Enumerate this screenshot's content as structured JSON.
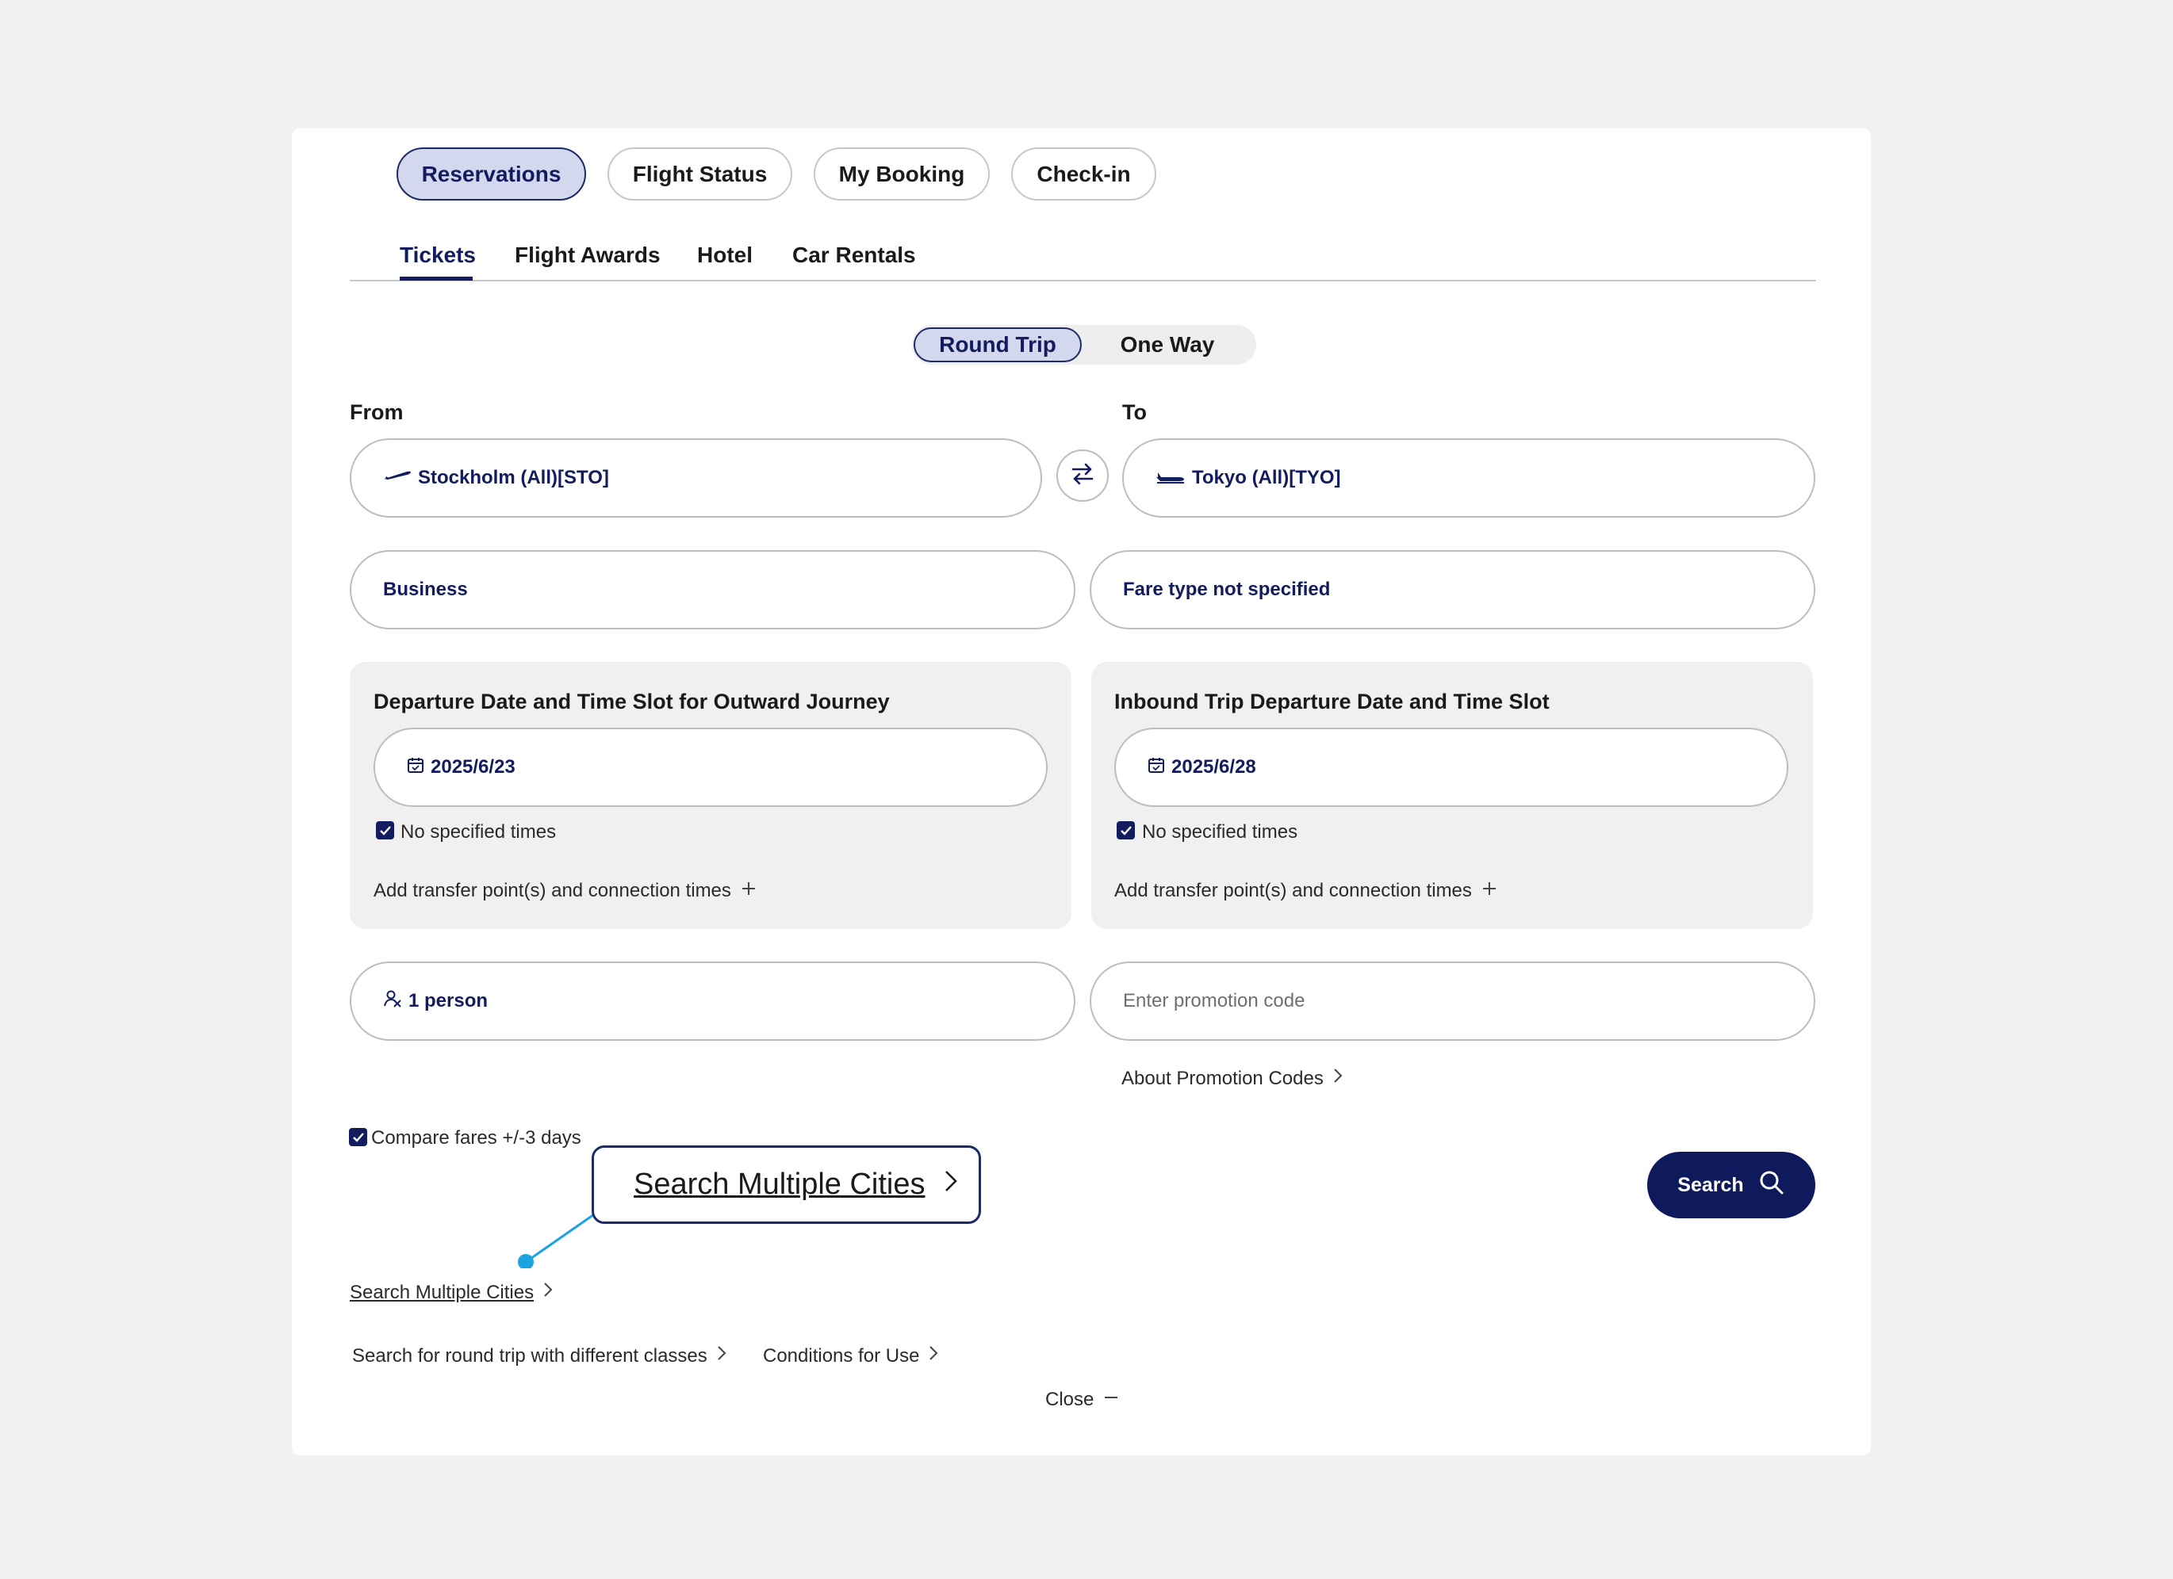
{
  "top_tabs": [
    {
      "label": "Reservations",
      "active": true
    },
    {
      "label": "Flight Status",
      "active": false
    },
    {
      "label": "My Booking",
      "active": false
    },
    {
      "label": "Check-in",
      "active": false
    }
  ],
  "sub_tabs": [
    {
      "label": "Tickets",
      "active": true
    },
    {
      "label": "Flight Awards",
      "active": false
    },
    {
      "label": "Hotel",
      "active": false
    },
    {
      "label": "Car Rentals",
      "active": false
    }
  ],
  "trip_type": {
    "round_trip": "Round Trip",
    "one_way": "One Way",
    "selected": "Round Trip"
  },
  "from": {
    "label": "From",
    "value": "Stockholm (All)[STO]"
  },
  "to": {
    "label": "To",
    "value": "Tokyo (All)[TYO]"
  },
  "cabin_class": {
    "value": "Business"
  },
  "fare_type": {
    "value": "Fare type not specified"
  },
  "outbound": {
    "title": "Departure Date and Time Slot for Outward Journey",
    "date": "2025/6/23",
    "no_times_label": "No specified times",
    "transfer_label": "Add transfer point(s) and connection times"
  },
  "inbound": {
    "title": "Inbound Trip Departure Date and Time Slot",
    "date": "2025/6/28",
    "no_times_label": "No specified times",
    "transfer_label": "Add transfer point(s) and connection times"
  },
  "passengers": {
    "value": "1 person"
  },
  "promo": {
    "placeholder": "Enter promotion code",
    "about_link": "About Promotion Codes"
  },
  "compare_fares": {
    "label": "Compare fares +/-3 days",
    "checked": true
  },
  "callout": {
    "label": "Search Multiple Cities"
  },
  "links": {
    "multi_city": "Search Multiple Cities",
    "different_classes": "Search for round trip with different classes",
    "conditions": "Conditions for Use",
    "close": "Close"
  },
  "search_button": {
    "label": "Search"
  },
  "colors": {
    "navy": "#0e1a5c",
    "active_fill": "#d3d8ef",
    "callout_dot": "#1aa3e0",
    "panel_bg": "#f0f0f0"
  }
}
